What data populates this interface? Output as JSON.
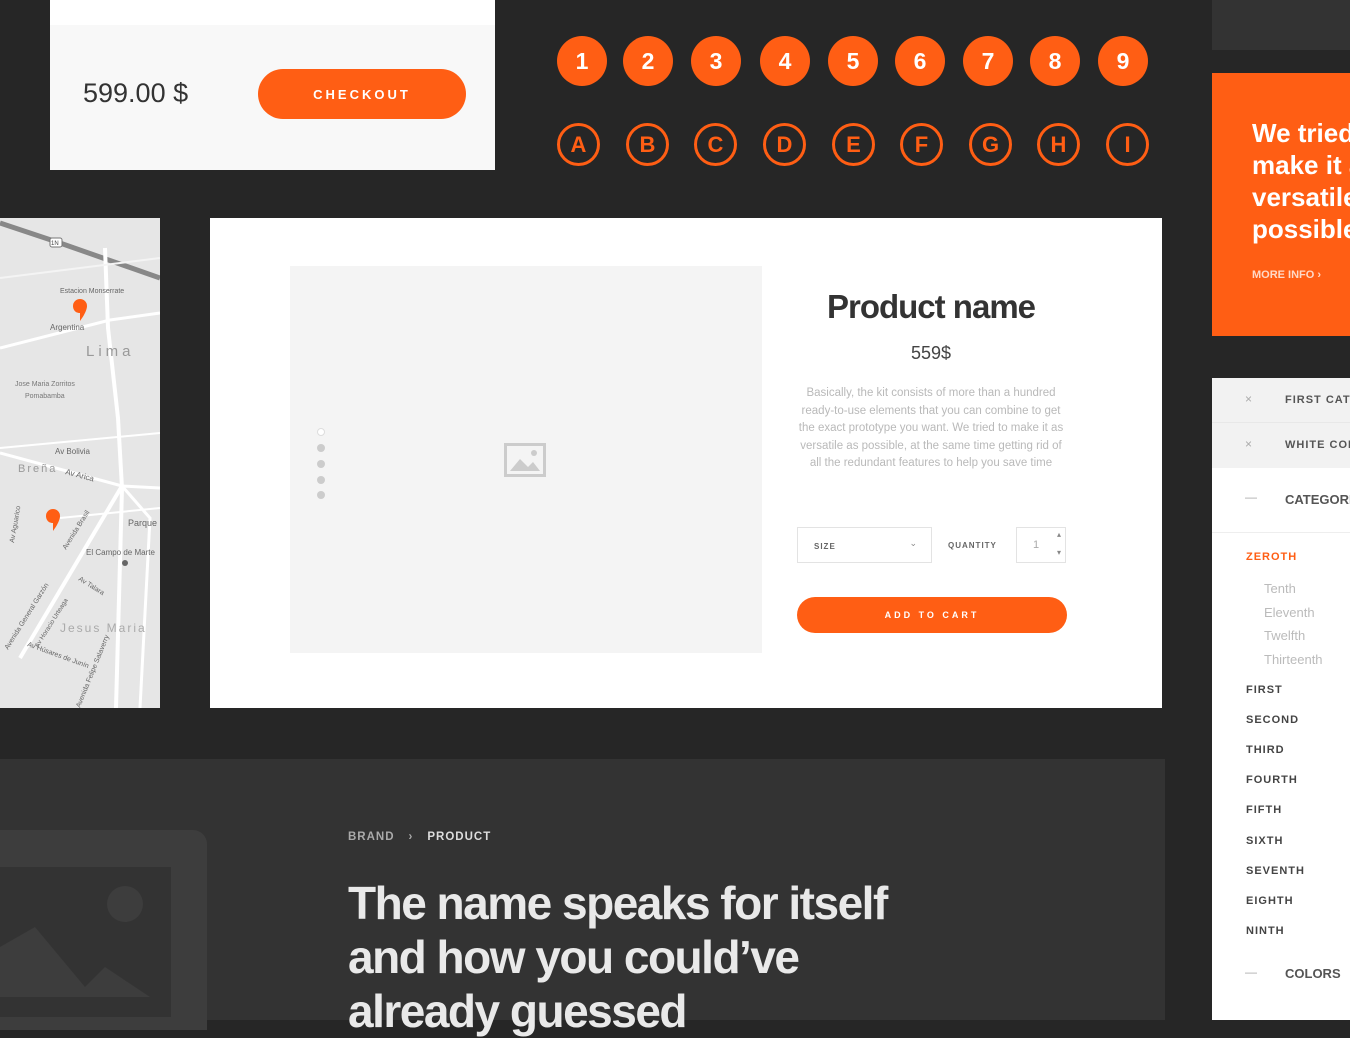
{
  "colors": {
    "accent": "#ff5e14",
    "background": "#262626"
  },
  "checkout": {
    "price": "599.00 $",
    "button": "CHECKOUT"
  },
  "numbers": [
    "1",
    "2",
    "3",
    "4",
    "5",
    "6",
    "7",
    "8",
    "9"
  ],
  "letters": [
    "A",
    "B",
    "C",
    "D",
    "E",
    "F",
    "G",
    "H",
    "I"
  ],
  "promo": {
    "heading": [
      "We tried to",
      "make it as",
      "versatile as",
      "possible"
    ],
    "more": "MORE INFO",
    "more_icon": "chevron-right-icon"
  },
  "map": {
    "labels": [
      "Estacion Monserrate",
      "Argentina",
      "Lima",
      "Jose Maria Zorritos",
      "Pomabamba",
      "Av Bolivia",
      "Breña",
      "Av Arica",
      "Av Aguarico",
      "Parque",
      "El Campo de Marte",
      "Avenida Brasil",
      "Av Talara",
      "Jesus Maria",
      "Avenida General Garzón",
      "Av Horacio Urteaga",
      "Av Húsares de Junín",
      "Avenida Felipe Salaverry",
      "1N"
    ]
  },
  "product": {
    "name": "Product name",
    "price": "559$",
    "description": "Basically, the kit consists of more than a hundred ready-to-use elements that you can combine to get the exact prototype you want. We tried to make it as versatile as possible, at the same time getting rid of all the redundant features to help you save time",
    "size_label": "SIZE",
    "quantity_label": "QUANTITY",
    "quantity": "1",
    "add_to_cart": "ADD TO CART"
  },
  "hero": {
    "breadcrumb": [
      "BRAND",
      "PRODUCT"
    ],
    "headline": [
      "The name speaks for itself",
      "and how you could’ve",
      "already guessed"
    ]
  },
  "sidebar": {
    "filters": [
      "FIRST CATEGORY",
      "WHITE COLOR"
    ],
    "category_heading": "CATEGORIES",
    "active": "ZEROTH",
    "subitems": [
      "Tenth",
      "Eleventh",
      "Twelfth",
      "Thirteenth"
    ],
    "items": [
      "FIRST",
      "SECOND",
      "THIRD",
      "FOURTH",
      "FIFTH",
      "SIXTH",
      "SEVENTH",
      "EIGHTH",
      "NINTH"
    ],
    "colors_heading": "COLORS"
  }
}
